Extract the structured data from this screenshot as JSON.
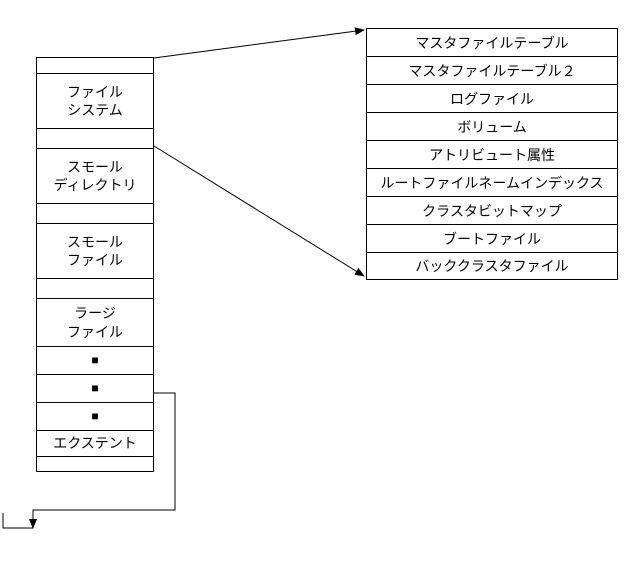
{
  "left": {
    "items": [
      {
        "label": ""
      },
      {
        "label": "ファイル\nシステム"
      },
      {
        "label": ""
      },
      {
        "label": "スモール\nディレクトリ"
      },
      {
        "label": ""
      },
      {
        "label": "スモール\nファイル"
      },
      {
        "label": ""
      },
      {
        "label": "ラージ\nファイル"
      },
      {
        "label": "■"
      },
      {
        "label": "■"
      },
      {
        "label": "■"
      },
      {
        "label": "エクステント"
      },
      {
        "label": ""
      }
    ]
  },
  "right": {
    "items": [
      {
        "label": "マスタファイルテーブル"
      },
      {
        "label": "マスタファイルテーブル２"
      },
      {
        "label": "ログファイル"
      },
      {
        "label": "ボリューム"
      },
      {
        "label": "アトリビュート属性"
      },
      {
        "label": "ルートファイルネームインデックス"
      },
      {
        "label": "クラスタビットマップ"
      },
      {
        "label": "ブートファイル"
      },
      {
        "label": "バッククラスタファイル"
      }
    ]
  }
}
